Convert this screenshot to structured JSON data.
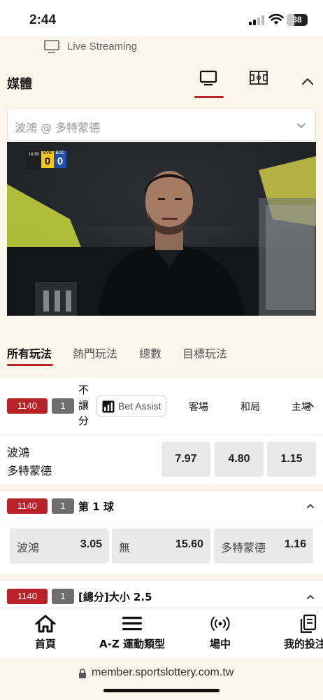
{
  "status": {
    "time": "2:44",
    "battery": "38"
  },
  "live": {
    "label": "Live Streaming"
  },
  "media": {
    "title": "媒體"
  },
  "match_select": {
    "value": "波鴻 @ 多特蒙德"
  },
  "scorebug": {
    "clock": "14:39",
    "home_team": "BVB",
    "home_score": "0",
    "away_team": "BOC",
    "away_score": "0"
  },
  "bet_tabs": [
    "所有玩法",
    "熱門玩法",
    "總數",
    "目標玩法"
  ],
  "main_market": {
    "code": "1140",
    "num": "1",
    "type_label": "不讓分",
    "bet_assist": "Bet Assist",
    "col_heads": [
      "客場",
      "和局",
      "主場"
    ],
    "team_away": "波鴻",
    "team_home": "多特蒙德",
    "odds": [
      "7.97",
      "4.80",
      "1.15"
    ]
  },
  "first_goal": {
    "code": "1140",
    "num": "1",
    "title": "第 1 球",
    "options": [
      {
        "name": "波鴻",
        "odd": "3.05"
      },
      {
        "name": "無",
        "odd": "15.60"
      },
      {
        "name": "多特蒙德",
        "odd": "1.16"
      }
    ]
  },
  "total_goals": {
    "code": "1140",
    "num": "1",
    "title": "[總分]大小 2.5"
  },
  "bottom_nav": [
    {
      "label": "首頁",
      "icon": "home-icon"
    },
    {
      "label": "A-Z 運動類型",
      "icon": "menu-icon"
    },
    {
      "label": "場中",
      "icon": "live-signal-icon"
    },
    {
      "label": "我的投注",
      "icon": "my-bets-icon"
    }
  ],
  "url": "member.sportslottery.com.tw",
  "colors": {
    "accent": "#b8232a",
    "badge_gray": "#6e6e6e",
    "odd_bg": "#e9e9e9",
    "page_bg": "#fbf5ec"
  }
}
